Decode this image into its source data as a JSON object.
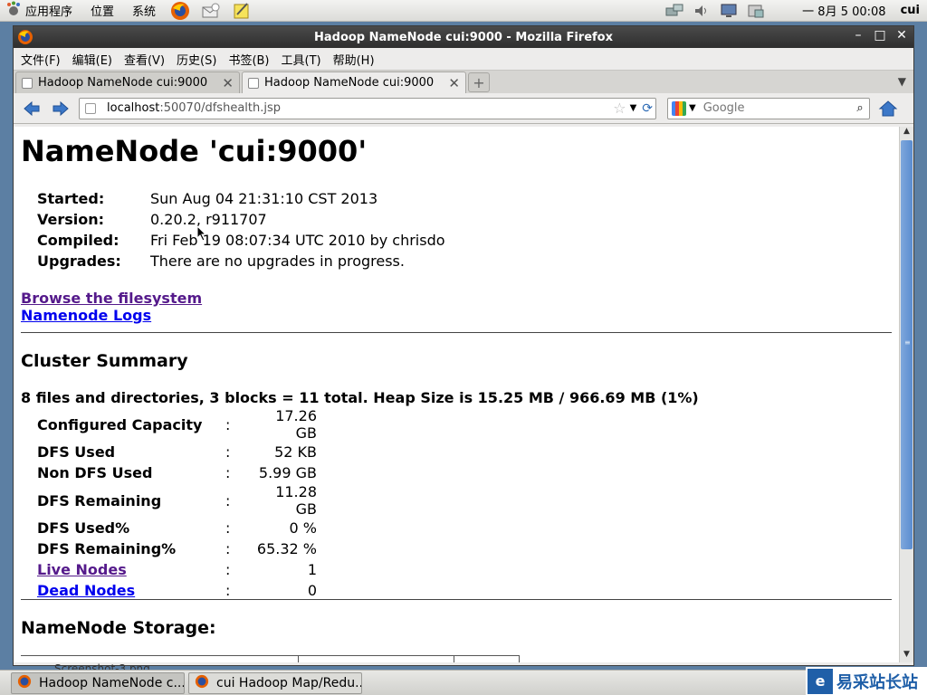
{
  "top_panel": {
    "menus": [
      "应用程序",
      "位置",
      "系统"
    ],
    "clock": "一 8月  5 00:08",
    "user": "cui"
  },
  "window": {
    "title": "Hadoop NameNode cui:9000 - Mozilla Firefox"
  },
  "menubar": [
    "文件(F)",
    "编辑(E)",
    "查看(V)",
    "历史(S)",
    "书签(B)",
    "工具(T)",
    "帮助(H)"
  ],
  "tabs": [
    {
      "title": "Hadoop NameNode cui:9000",
      "active": false
    },
    {
      "title": "Hadoop NameNode cui:9000",
      "active": true
    }
  ],
  "navbar": {
    "url_host": "localhost",
    "url_rest": ":50070/dfshealth.jsp",
    "search_placeholder": "Google"
  },
  "page": {
    "title": "NameNode 'cui:9000'",
    "info": [
      {
        "key": "Started:",
        "value": "Sun Aug 04 21:31:10 CST 2013"
      },
      {
        "key": "Version:",
        "value": "0.20.2, r911707"
      },
      {
        "key": "Compiled:",
        "value": "Fri Feb 19 08:07:34 UTC 2010 by chrisdo"
      },
      {
        "key": "Upgrades:",
        "value": "There are no upgrades in progress."
      }
    ],
    "links": [
      "Browse the filesystem",
      "Namenode Logs"
    ],
    "cluster_summary_heading": "Cluster Summary",
    "summary_line": "8 files and directories, 3 blocks = 11 total. Heap Size is 15.25 MB / 966.69 MB (1%)",
    "stats": [
      {
        "key": "Configured Capacity",
        "value": "17.26 GB",
        "link": false
      },
      {
        "key": "DFS Used",
        "value": "52 KB",
        "link": false
      },
      {
        "key": "Non DFS Used",
        "value": "5.99 GB",
        "link": false
      },
      {
        "key": "DFS Remaining",
        "value": "11.28 GB",
        "link": false
      },
      {
        "key": "DFS Used%",
        "value": "0 %",
        "link": false
      },
      {
        "key": "DFS Remaining%",
        "value": "65.32 %",
        "link": false
      },
      {
        "key": "Live Nodes",
        "value": "1",
        "link": true
      },
      {
        "key": "Dead Nodes",
        "value": "0",
        "link": true
      }
    ],
    "separator": ":",
    "storage_heading": "NameNode Storage:"
  },
  "taskbar": [
    {
      "label": "Hadoop NameNode c...",
      "active": true
    },
    {
      "label": "cui Hadoop Map/Redu...",
      "active": false
    }
  ],
  "desktop_file": "Screenshot-3.png",
  "watermark": "易采站长站"
}
